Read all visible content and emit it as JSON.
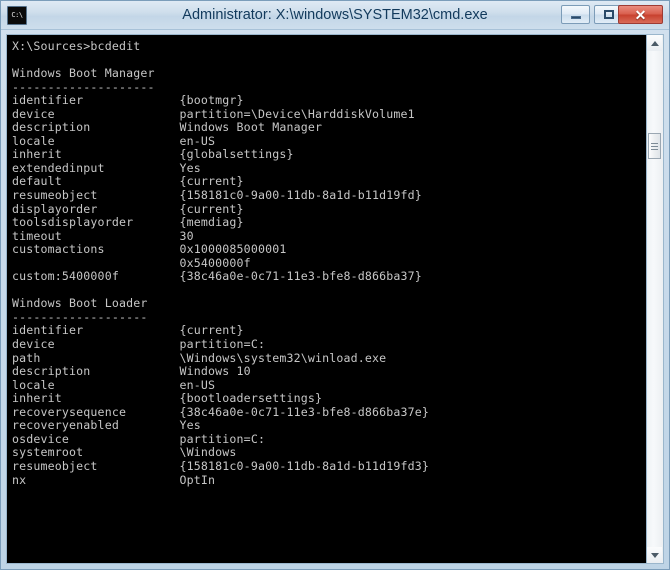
{
  "window": {
    "title": "Administrator: X:\\windows\\SYSTEM32\\cmd.exe",
    "icon": "cmd-icon",
    "icon_text": "C:\\",
    "buttons": {
      "minimize": "minimize",
      "maximize": "maximize",
      "close": "✕"
    }
  },
  "scrollbar": {
    "up_arrow": "scroll-up",
    "down_arrow": "scroll-down",
    "thumb": "scroll-thumb"
  },
  "console": {
    "prompt_line": "X:\\Sources>bcdedit",
    "blank": "",
    "sections": [
      {
        "heading": "Windows Boot Manager",
        "rule": "--------------------",
        "entries": [
          {
            "key": "identifier",
            "value": "{bootmgr}"
          },
          {
            "key": "device",
            "value": "partition=\\Device\\HarddiskVolume1"
          },
          {
            "key": "description",
            "value": "Windows Boot Manager"
          },
          {
            "key": "locale",
            "value": "en-US"
          },
          {
            "key": "inherit",
            "value": "{globalsettings}"
          },
          {
            "key": "extendedinput",
            "value": "Yes"
          },
          {
            "key": "default",
            "value": "{current}"
          },
          {
            "key": "resumeobject",
            "value": "{158181c0-9a00-11db-8a1d-b11d19fd}"
          },
          {
            "key": "displayorder",
            "value": "{current}"
          },
          {
            "key": "toolsdisplayorder",
            "value": "{memdiag}"
          },
          {
            "key": "timeout",
            "value": "30"
          },
          {
            "key": "customactions",
            "value": "0x1000085000001"
          },
          {
            "key": "",
            "value": "0x5400000f"
          },
          {
            "key": "custom:5400000f",
            "value": "{38c46a0e-0c71-11e3-bfe8-d866ba37}"
          }
        ]
      },
      {
        "heading": "Windows Boot Loader",
        "rule": "-------------------",
        "entries": [
          {
            "key": "identifier",
            "value": "{current}"
          },
          {
            "key": "device",
            "value": "partition=C:"
          },
          {
            "key": "path",
            "value": "\\Windows\\system32\\winload.exe"
          },
          {
            "key": "description",
            "value": "Windows 10"
          },
          {
            "key": "locale",
            "value": "en-US"
          },
          {
            "key": "inherit",
            "value": "{bootloadersettings}"
          },
          {
            "key": "recoverysequence",
            "value": "{38c46a0e-0c71-11e3-bfe8-d866ba37e}"
          },
          {
            "key": "recoveryenabled",
            "value": "Yes"
          },
          {
            "key": "osdevice",
            "value": "partition=C:"
          },
          {
            "key": "systemroot",
            "value": "\\Windows"
          },
          {
            "key": "resumeobject",
            "value": "{158181c0-9a00-11db-8a1d-b11d19fd3}"
          },
          {
            "key": "nx",
            "value": "OptIn"
          }
        ]
      }
    ]
  }
}
